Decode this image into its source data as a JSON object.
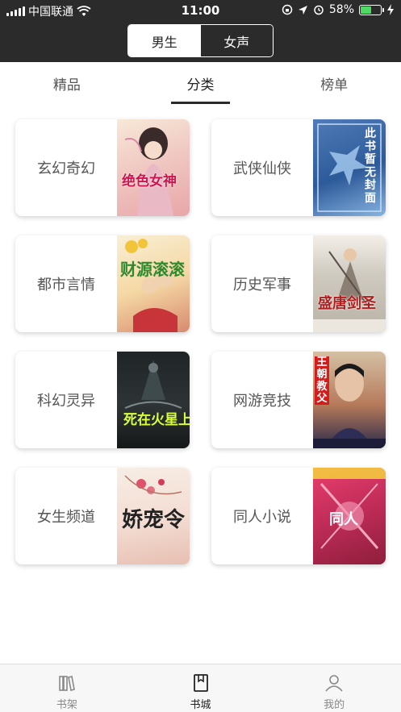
{
  "status_bar": {
    "carrier": "中国联通",
    "time": "11:00",
    "battery_percent": "58%",
    "battery_level": 0.58
  },
  "gender_switch": {
    "options": [
      "男生",
      "女声"
    ],
    "selected": "男生"
  },
  "tabs": [
    {
      "label": "精品"
    },
    {
      "label": "分类"
    },
    {
      "label": "榜单"
    }
  ],
  "active_tab": "分类",
  "categories": [
    {
      "label": "玄幻奇幻",
      "cover_title": "绝色女神",
      "cover_icon": "fantasy-cover-icon"
    },
    {
      "label": "武侠仙侠",
      "cover_title": "此书暂无封面",
      "cover_icon": "no-cover-icon"
    },
    {
      "label": "都市言情",
      "cover_title": "财源滚滚",
      "cover_icon": "urban-cover-icon"
    },
    {
      "label": "历史军事",
      "cover_title": "盛唐剑圣",
      "cover_icon": "history-cover-icon"
    },
    {
      "label": "科幻灵异",
      "cover_title": "死在火星上",
      "cover_icon": "scifi-cover-icon"
    },
    {
      "label": "网游竞技",
      "cover_title": "王朝教父",
      "cover_icon": "game-cover-icon"
    },
    {
      "label": "女生频道",
      "cover_title": "娇宠令",
      "cover_icon": "female-cover-icon"
    },
    {
      "label": "同人小说",
      "cover_title": "同人",
      "cover_icon": "fanfic-cover-icon"
    }
  ],
  "bottom_nav": [
    {
      "label": "书架",
      "icon": "bookshelf-icon"
    },
    {
      "label": "书城",
      "icon": "bookstore-icon"
    },
    {
      "label": "我的",
      "icon": "profile-icon"
    }
  ],
  "colors": {
    "header_bg": "#2b2b2b",
    "battery_green": "#4cd964",
    "text_primary": "#222222",
    "text_secondary": "#555555"
  }
}
